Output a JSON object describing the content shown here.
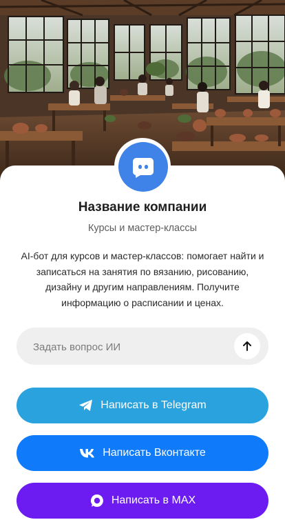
{
  "hero": {
    "icon": "workshop-illustration"
  },
  "company": {
    "avatar_icon": "chat-bot-icon",
    "name": "Название компании",
    "subtitle": "Курсы и мастер-классы",
    "description": "AI-бот для курсов и мастер-классов: помогает найти и записаться на занятия по вязанию, рисованию, дизайну и другим направлениям. Получите информацию о расписании и ценах."
  },
  "ask": {
    "placeholder": "Задать вопрос ИИ",
    "value": "",
    "send_icon": "arrow-up-icon"
  },
  "actions": {
    "telegram_label": "Написать в Telegram",
    "vk_label": "Написать Вконтакте",
    "max_label": "Написать в MAX"
  },
  "colors": {
    "avatar": "#3f82e8",
    "telegram": "#2aa2de",
    "vk": "#0f7bfb",
    "max": "#6c1bf1",
    "input_bg": "#efefef"
  }
}
